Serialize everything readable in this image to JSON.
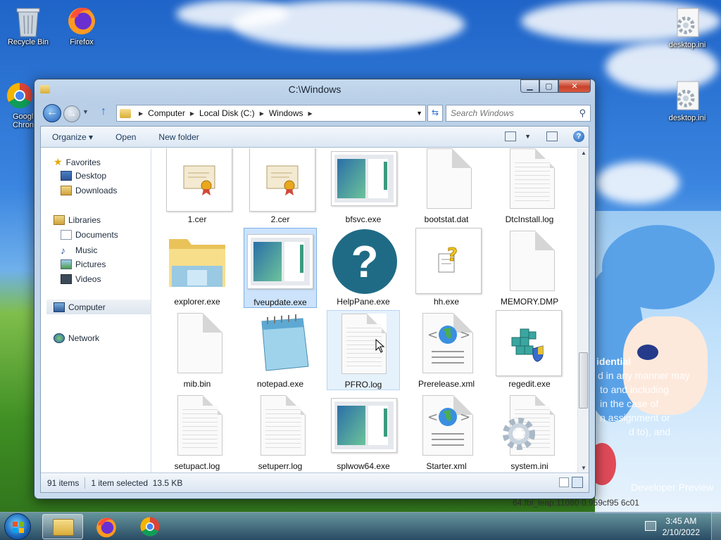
{
  "desktop": {
    "icons": [
      {
        "label": "Recycle Bin"
      },
      {
        "label": "Firefox"
      },
      {
        "label": "Googl Chron"
      },
      {
        "label": "desktop.ini"
      },
      {
        "label": "desktop.ini"
      }
    ],
    "watermark": {
      "line1": "idential",
      "line2": "d in any manner may",
      "line3": "to and including",
      "line4": "in the case of",
      "line5": "n assignment or",
      "line6": "d to), and",
      "line7": "Developer Preview",
      "line8": "64.fbl_leap.11080 0.959cf95 6c01"
    }
  },
  "window": {
    "title": "C:\\Windows",
    "address": {
      "crumbs": [
        "Computer",
        "Local Disk (C:)",
        "Windows"
      ]
    },
    "search_placeholder": "Search Windows",
    "toolbar": {
      "organize": "Organize ▾",
      "open": "Open",
      "new_folder": "New folder"
    },
    "nav": {
      "favorites": "Favorites",
      "desktop": "Desktop",
      "downloads": "Downloads",
      "libraries": "Libraries",
      "documents": "Documents",
      "music": "Music",
      "pictures": "Pictures",
      "videos": "Videos",
      "computer": "Computer",
      "network": "Network"
    },
    "files": [
      {
        "name": "1.cer",
        "type": "cert"
      },
      {
        "name": "2.cer",
        "type": "cert"
      },
      {
        "name": "bfsvc.exe",
        "type": "exe"
      },
      {
        "name": "bootstat.dat",
        "type": "blank"
      },
      {
        "name": "DtcInstall.log",
        "type": "text"
      },
      {
        "name": "explorer.exe",
        "type": "explorer"
      },
      {
        "name": "fveupdate.exe",
        "type": "exe"
      },
      {
        "name": "HelpPane.exe",
        "type": "help"
      },
      {
        "name": "hh.exe",
        "type": "hh"
      },
      {
        "name": "MEMORY.DMP",
        "type": "blank"
      },
      {
        "name": "mib.bin",
        "type": "blank"
      },
      {
        "name": "notepad.exe",
        "type": "notepad"
      },
      {
        "name": "PFRO.log",
        "type": "text"
      },
      {
        "name": "Prerelease.xml",
        "type": "xml"
      },
      {
        "name": "regedit.exe",
        "type": "regedit"
      },
      {
        "name": "setupact.log",
        "type": "text"
      },
      {
        "name": "setuperr.log",
        "type": "text"
      },
      {
        "name": "splwow64.exe",
        "type": "exe"
      },
      {
        "name": "Starter.xml",
        "type": "xml"
      },
      {
        "name": "system.ini",
        "type": "ini"
      }
    ],
    "selected_file": "fveupdate.exe",
    "status": {
      "items": "91 items",
      "selected": "1 item selected  13.5 KB"
    }
  },
  "taskbar": {
    "time": "3:45 AM",
    "date": "2/10/2022"
  }
}
